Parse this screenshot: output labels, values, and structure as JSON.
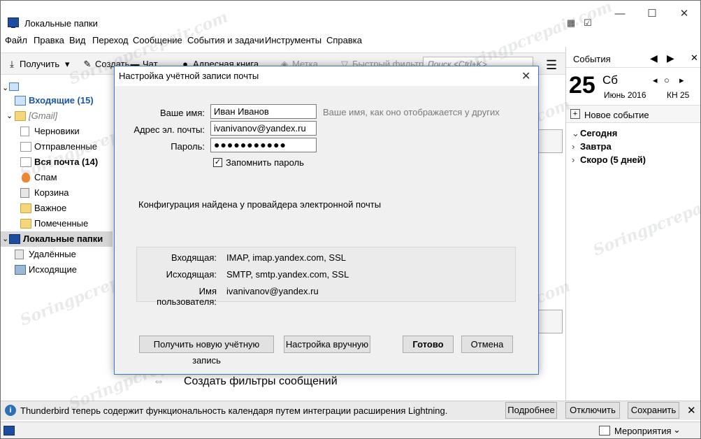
{
  "window": {
    "title": "Локальные папки",
    "minimize": "—",
    "maximize": "☐",
    "close": "✕"
  },
  "menu": [
    "Файл",
    "Правка",
    "Вид",
    "Переход",
    "Сообщение",
    "События и задачи",
    "Инструменты",
    "Справка"
  ],
  "toolbar": {
    "get": "Получить",
    "compose": "Создать",
    "chat": "Чат",
    "addressbook": "Адресная книга",
    "tag": "Метка",
    "quickfilter": "Быстрый фильтр",
    "search_placeholder": "Поиск <Ctrl+K>"
  },
  "folders": [
    {
      "label": "Входящие (15)",
      "bold": true,
      "blue": true
    },
    {
      "label": "[Gmail]",
      "italic": true
    },
    {
      "label": "Черновики"
    },
    {
      "label": "Отправленные"
    },
    {
      "label": "Вся почта (14)",
      "bold": true
    },
    {
      "label": "Спам"
    },
    {
      "label": "Корзина"
    },
    {
      "label": "Важное"
    },
    {
      "label": "Помеченные"
    },
    {
      "label": "Локальные папки",
      "bold": true
    },
    {
      "label": "Удалённые"
    },
    {
      "label": "Исходящие"
    }
  ],
  "content": {
    "create_filters": "Создать фильтры сообщений"
  },
  "events": {
    "title": "События",
    "day": "25",
    "dow": "Сб",
    "month": "Июнь 2016",
    "week": "КН 25",
    "new_event": "Новое событие",
    "groups": [
      "Сегодня",
      "Завтра",
      "Скоро (5 дней)"
    ]
  },
  "notification": {
    "message": "Thunderbird теперь содержит функциональность календаря путем интеграции расширения Lightning.",
    "more": "Подробнее",
    "disable": "Отключить",
    "keep": "Сохранить"
  },
  "statusbar": {
    "events": "Мероприятия"
  },
  "dialog": {
    "title": "Настройка учётной записи почты",
    "name_label": "Ваше имя:",
    "name_value": "Иван Иванов",
    "name_hint": "Ваше имя, как оно отображается у других",
    "email_label": "Адрес эл. почты:",
    "email_value": "ivanivanov@yandex.ru",
    "password_label": "Пароль:",
    "password_value": "●●●●●●●●●●●",
    "remember": "Запомнить пароль",
    "found": "Конфигурация найдена у провайдера электронной почты",
    "incoming_label": "Входящая:",
    "incoming_value": "IMAP, imap.yandex.com, SSL",
    "outgoing_label": "Исходящая:",
    "outgoing_value": "SMTP, smtp.yandex.com, SSL",
    "username_label": "Имя пользователя:",
    "username_value": "ivanivanov@yandex.ru",
    "btn_new": "Получить новую учётную запись",
    "btn_manual": "Настройка вручную",
    "btn_done": "Готово",
    "btn_cancel": "Отмена"
  },
  "watermark": "Soringpcrepair.com"
}
